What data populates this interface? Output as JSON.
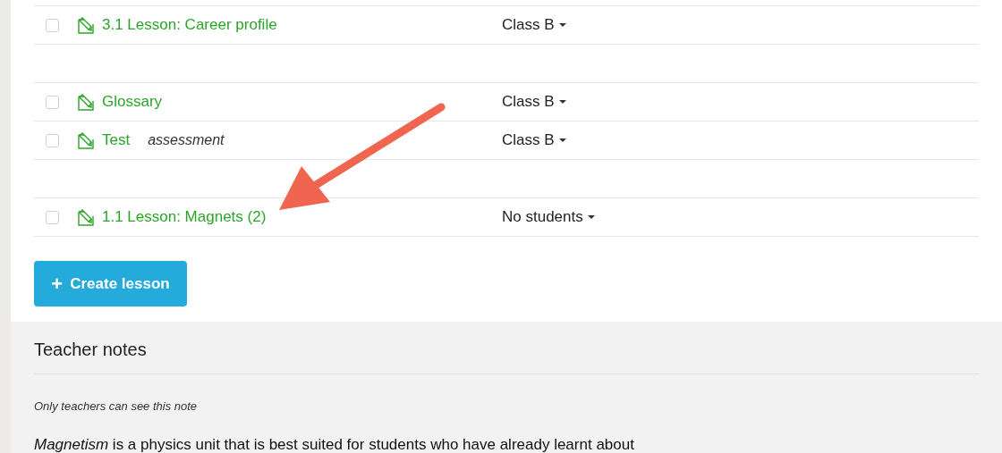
{
  "lessons": [
    {
      "kind": "lesson",
      "title": "3.1 Lesson: Career profile",
      "checked": false,
      "class": "Class B"
    },
    {
      "kind": "spacer"
    },
    {
      "kind": "lesson",
      "title": "Glossary",
      "checked": false,
      "class": "Class B"
    },
    {
      "kind": "lesson",
      "title": "Test",
      "tag": "assessment",
      "checked": false,
      "class": "Class B"
    },
    {
      "kind": "spacer"
    },
    {
      "kind": "lesson",
      "title": "1.1 Lesson: Magnets (2)",
      "checked": false,
      "class": "No students"
    }
  ],
  "create_button": {
    "icon": "+",
    "label": "Create lesson"
  },
  "teacher_notes": {
    "title": "Teacher notes",
    "visibility": "Only teachers can see this note",
    "text": "*Magnetism* is a physics unit that is best suited for students who have already learnt about"
  }
}
